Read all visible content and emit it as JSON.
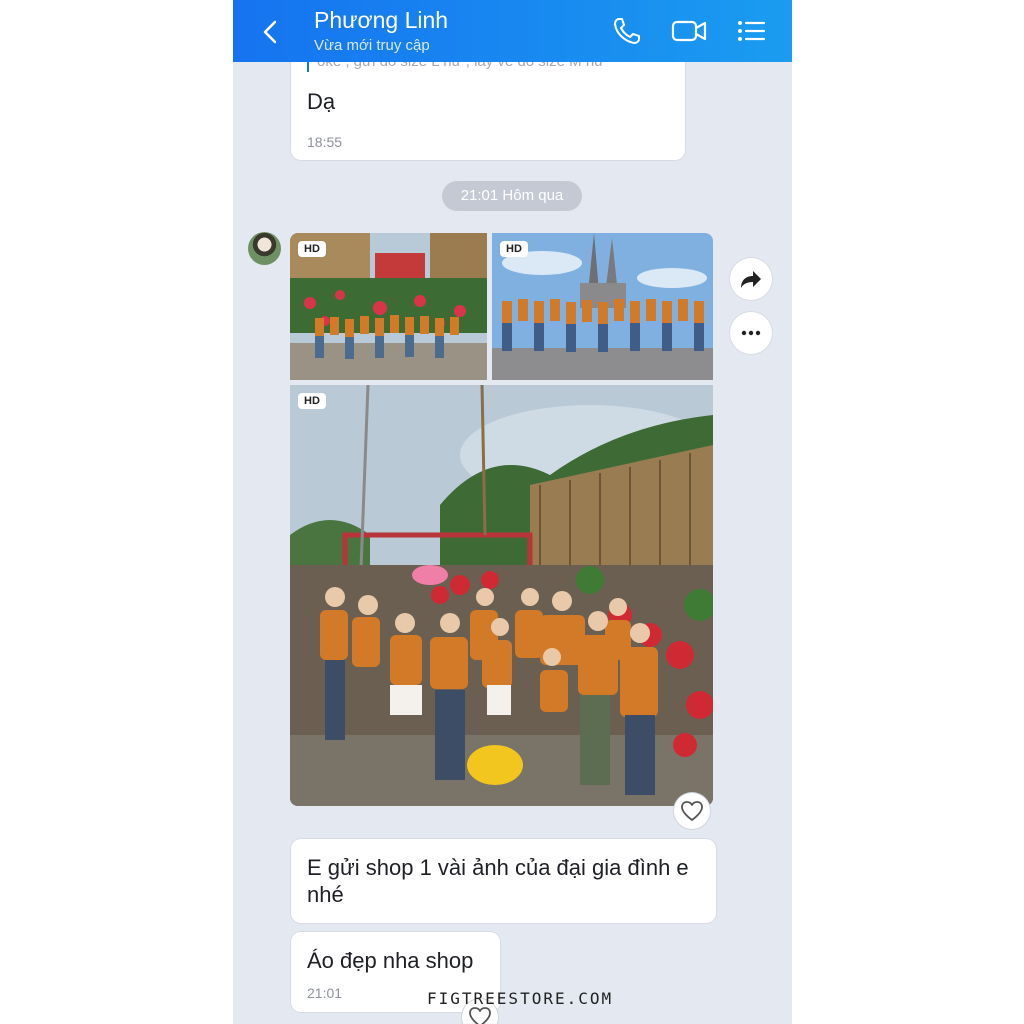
{
  "header": {
    "contact_name": "Phương Linh",
    "status": "Vừa mới truy cập",
    "icons": [
      "back-icon",
      "phone-icon",
      "video-call-icon",
      "menu-list-icon"
    ],
    "gradient": [
      "#1673f0",
      "#1a9cf0"
    ]
  },
  "messages": {
    "first": {
      "quoted_text": "oke , gửi đổ size L nữ , lấy về đổ size M nữ",
      "text": "Dạ",
      "time": "18:55"
    },
    "date_separator": "21:01 Hôm qua",
    "photos": {
      "badges": [
        "HD",
        "HD",
        "HD"
      ],
      "actions": [
        "share-icon",
        "more-icon"
      ],
      "reaction": "heart-icon"
    },
    "second": {
      "text": "E gửi shop 1 vài ảnh của đại gia đình e nhé"
    },
    "third": {
      "text": "Áo đẹp nha shop",
      "time": "21:01"
    }
  },
  "watermark": "FIGTREESTORE.COM"
}
